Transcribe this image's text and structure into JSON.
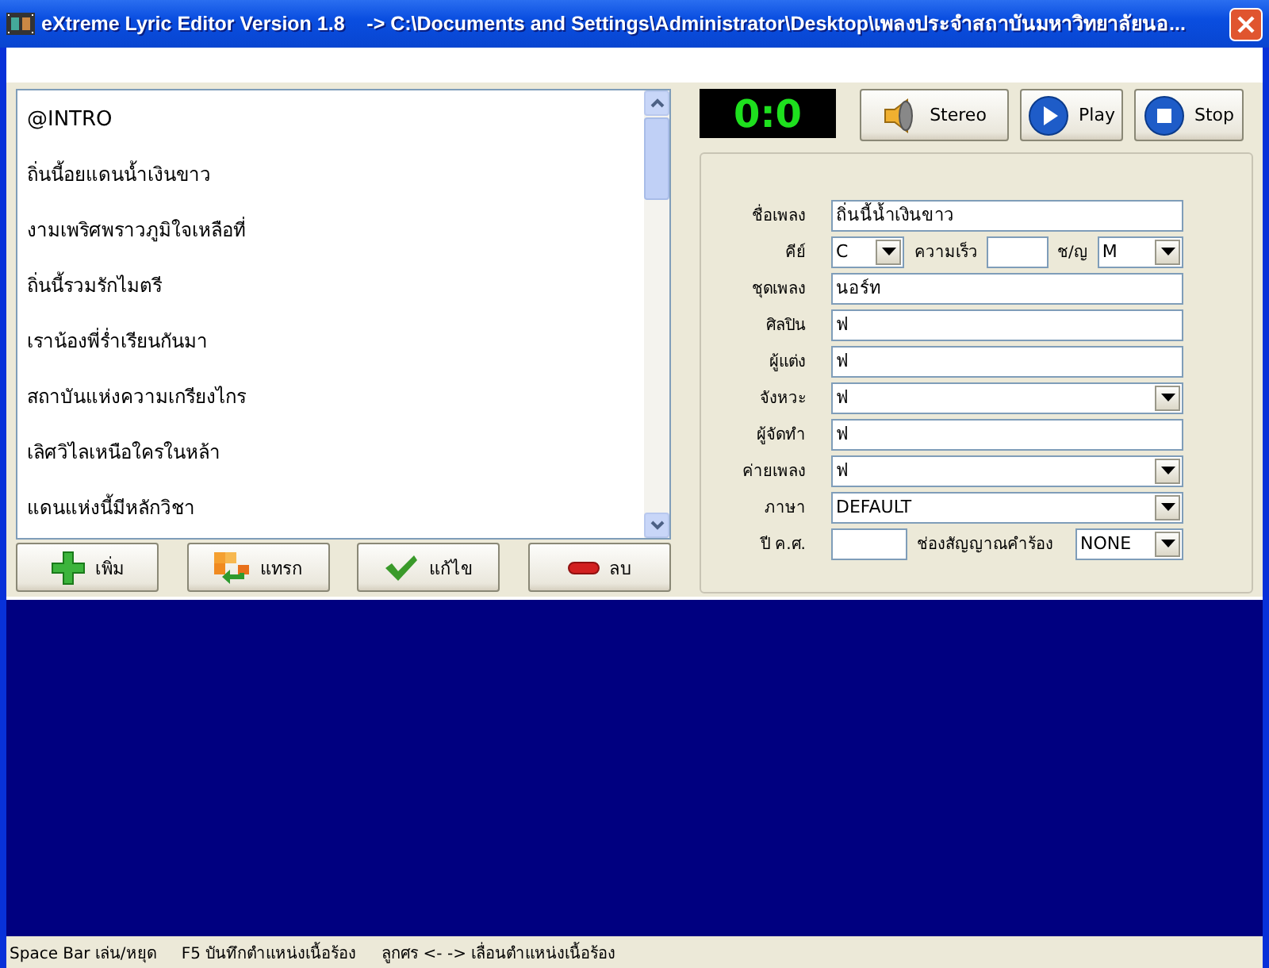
{
  "window": {
    "title": "eXtreme Lyric Editor Version 1.8    -> C:\\Documents and Settings\\Administrator\\Desktop\\เพลงประจำสถาบันมหาวิทยาลัยนอ..."
  },
  "lyrics": [
    "@INTRO",
    "ถิ่นนี้อยแดนน้ำเงินขาว",
    "งามเพริศพราวภูมิใจเหลือที่",
    "ถิ่นนี้รวมรักไมตรี",
    "เราน้องพี่ร่ำเรียนกันมา",
    "สถาบันแห่งความเกรียงไกร",
    "เลิศวิไลเหนือใครในหล้า",
    "แดนแห่งนี้มีหลักวิชา"
  ],
  "list_buttons": [
    {
      "label": "เพิ่ม",
      "kind": "add"
    },
    {
      "label": "แทรก",
      "kind": "insert"
    },
    {
      "label": "แก้ไข",
      "kind": "edit"
    },
    {
      "label": "ลบ",
      "kind": "delete"
    }
  ],
  "timer": "0:0",
  "player_buttons": [
    {
      "label": "Stereo",
      "kind": "speaker"
    },
    {
      "label": "Play",
      "kind": "play"
    },
    {
      "label": "Stop",
      "kind": "stop"
    }
  ],
  "form": [
    {
      "label": "ชื่อเพลง",
      "parts": [
        {
          "kind": "text",
          "value": "ถิ่นนี้น้ำเงินขาว"
        }
      ]
    },
    {
      "label": "คีย์",
      "parts": [
        {
          "kind": "combo",
          "value": "C"
        },
        {
          "kind": "label",
          "value": "ความเร็ว"
        },
        {
          "kind": "text"
        },
        {
          "kind": "label",
          "value": "ช/ญ"
        },
        {
          "kind": "combo",
          "value": "M"
        }
      ]
    },
    {
      "label": "ชุดเพลง",
      "parts": [
        {
          "kind": "text",
          "value": "นอร์ท"
        }
      ]
    },
    {
      "label": "ศิลปิน",
      "parts": [
        {
          "kind": "text",
          "value": "ฟ"
        }
      ]
    },
    {
      "label": "ผู้แต่ง",
      "parts": [
        {
          "kind": "text",
          "value": "ฟ"
        }
      ]
    },
    {
      "label": "จังหวะ",
      "parts": [
        {
          "kind": "combo",
          "value": "ฟ"
        }
      ]
    },
    {
      "label": "ผู้จัดทำ",
      "parts": [
        {
          "kind": "text",
          "value": "ฟ"
        }
      ]
    },
    {
      "label": "ค่ายเพลง",
      "parts": [
        {
          "kind": "combo",
          "value": "ฟ"
        }
      ]
    },
    {
      "label": "ภาษา",
      "parts": [
        {
          "kind": "combo",
          "value": "DEFAULT"
        }
      ]
    },
    {
      "label": "ปี ค.ศ.",
      "parts": [
        {
          "kind": "text"
        },
        {
          "kind": "label",
          "value": "ช่องสัญญาณคำร้อง"
        },
        {
          "kind": "combo",
          "value": "NONE"
        }
      ]
    }
  ],
  "status_bar": [
    "Space Bar เล่น/หยุด",
    "F5 บันทึกตำแหน่งเนื้อร้อง",
    "ลูกศร  <- -> เลื่อนตำแหน่งเนื้อร้อง"
  ]
}
